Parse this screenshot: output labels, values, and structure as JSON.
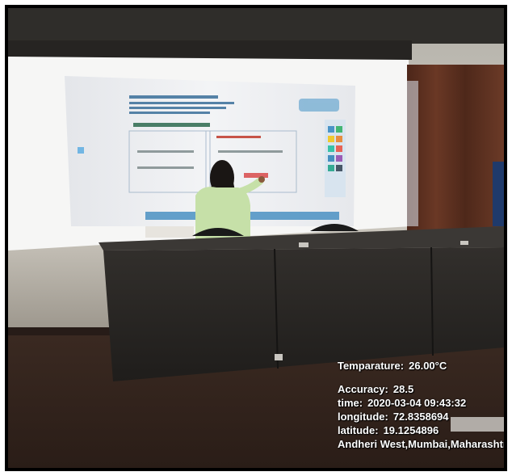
{
  "overlay": {
    "temperature_label": "Temparature:",
    "temperature_value": "26.00°C",
    "accuracy_label": "Accuracy:",
    "accuracy_value": "28.5",
    "time_label": "time:",
    "time_value": "2020-03-04 09:43:32",
    "longitude_label": "longitude:",
    "longitude_value": "72.8358694",
    "latitude_label": "latitude:",
    "latitude_value": "19.1254896",
    "address": "Andheri West,Mumbai,Maharashtr"
  },
  "colors": {
    "overlay_text": "#ffffff",
    "screen": "#eef0f4",
    "desk": "#2a2826",
    "curtain": "#5a2e1e",
    "wall": "#d8d6cf"
  }
}
